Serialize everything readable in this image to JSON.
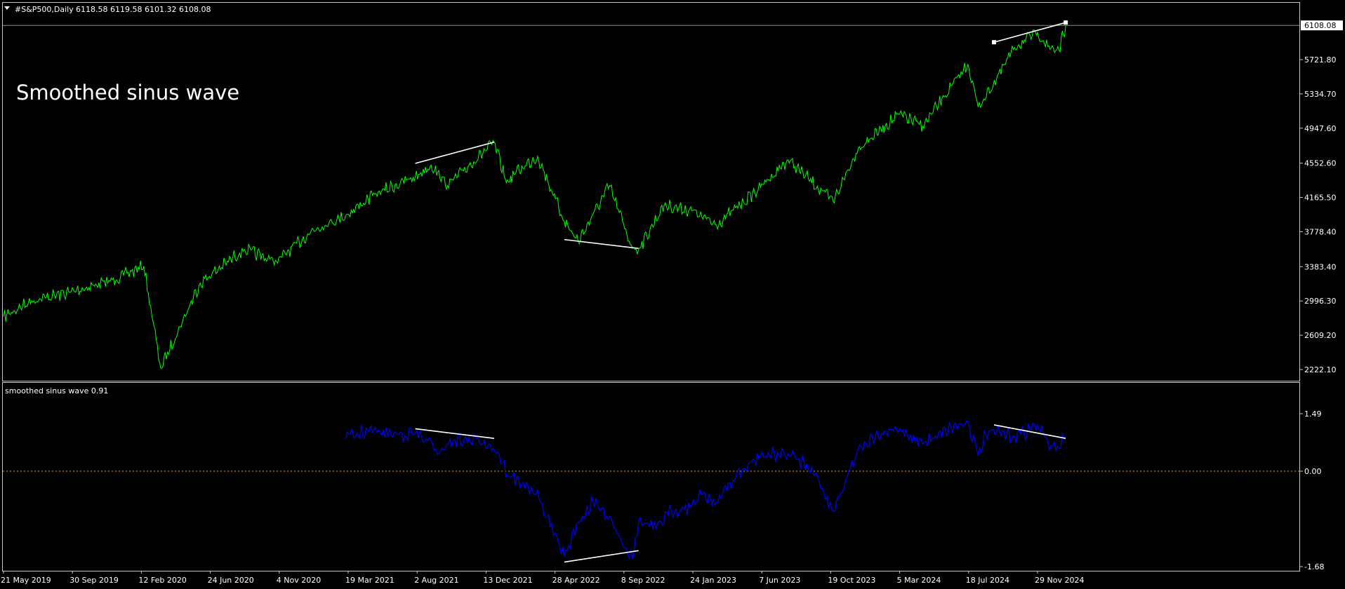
{
  "colors": {
    "background": "#000000",
    "frame": "#c8c8c8",
    "text": "#ffffff",
    "price_line": "#00ff00",
    "indicator_line": "#0000ff",
    "zero_line": "#daa520",
    "trendline": "#ffffff",
    "current_price_marker": "#ffffff"
  },
  "header": {
    "symbol_menu_icon": "triangle-down-icon",
    "symbol": "#S&P500,Daily",
    "ohlc": "6118.58 6119.58 6101.32 6108.08"
  },
  "main_panel": {
    "annotation": "Smoothed sinus wave",
    "y_ticks": [
      "5721.80",
      "5334.70",
      "4947.60",
      "4552.60",
      "4165.50",
      "3778.40",
      "3383.40",
      "2996.30",
      "2609.20",
      "2222.10"
    ],
    "current_price": "6108.08"
  },
  "sub_panel": {
    "label": "smoothed sinus wave 0.91",
    "y_ticks": [
      "1.49",
      "0.00",
      "-1.68"
    ]
  },
  "x_ticks": [
    "21 May 2019",
    "30 Sep 2019",
    "12 Feb 2020",
    "24 Jun 2020",
    "4 Nov 2020",
    "19 Mar 2021",
    "2 Aug 2021",
    "13 Dec 2021",
    "28 Apr 2022",
    "8 Sep 2022",
    "24 Jan 2023",
    "7 Jun 2023",
    "19 Oct 2023",
    "5 Mar 2024",
    "18 Jul 2024",
    "29 Nov 2024"
  ],
  "chart_data": [
    {
      "type": "line",
      "series": [
        {
          "values_note": "",
          "x": [
            "2019-05-21",
            "2019-07-15",
            "2019-09-30",
            "2019-12-15",
            "2020-02-19",
            "2020-03-23",
            "2020-06-08",
            "2020-09-02",
            "2020-11-04",
            "2021-01-15",
            "2021-03-19",
            "2021-05-15",
            "2021-08-02",
            "2021-09-02",
            "2021-10-04",
            "2022-01-03",
            "2022-01-27",
            "2022-02-15",
            "2022-03-29",
            "2022-05-20",
            "2022-06-16",
            "2022-08-16",
            "2022-09-30",
            "2022-10-12",
            "2022-12-01",
            "2023-01-24",
            "2023-03-13",
            "2023-06-07",
            "2023-07-31",
            "2023-10-27",
            "2023-12-15",
            "2024-03-05",
            "2024-04-19",
            "2024-07-16",
            "2024-08-05",
            "2024-09-10",
            "2024-10-15",
            "2024-11-29",
            "2024-12-19",
            "2025-01-10",
            "2025-01-23"
          ],
          "y": [
            2820,
            3000,
            3100,
            3220,
            3390,
            2237,
            3200,
            3580,
            3440,
            3800,
            3960,
            4200,
            4400,
            4530,
            4300,
            4790,
            4330,
            4450,
            4630,
            3900,
            3667,
            4300,
            3590,
            3577,
            4080,
            4015,
            3855,
            4280,
            4590,
            4120,
            4720,
            5110,
            4967,
            5670,
            5186,
            5500,
            5860,
            6030,
            5870,
            5827,
            6108
          ]
        }
      ],
      "y_axis_ticks": [
        5721.8,
        5334.7,
        4947.6,
        4552.6,
        4165.5,
        3778.4,
        3383.4,
        2996.3,
        2609.2,
        2222.1
      ],
      "x_tick_labels": [
        "21 May 2019",
        "30 Sep 2019",
        "12 Feb 2020",
        "24 Jun 2020",
        "4 Nov 2020",
        "19 Mar 2021",
        "2 Aug 2021",
        "13 Dec 2021",
        "28 Apr 2022",
        "8 Sep 2022",
        "24 Jan 2023",
        "7 Jun 2023",
        "19 Oct 2023",
        "5 Mar 2024",
        "18 Jul 2024",
        "29 Nov 2024"
      ],
      "annotations": [
        {
          "text": "Smoothed sinus wave"
        },
        {
          "kind": "trendline",
          "x": [
            "2021-08-02",
            "2022-01-03"
          ],
          "y": [
            4550,
            4790
          ]
        },
        {
          "kind": "trendline",
          "x": [
            "2022-05-20",
            "2022-10-12"
          ],
          "y": [
            3690,
            3590
          ]
        },
        {
          "kind": "trendline",
          "x": [
            "2024-09-05",
            "2025-01-23"
          ],
          "y": [
            5918,
            6140
          ]
        }
      ],
      "grid": false,
      "legend": "none"
    },
    {
      "type": "line",
      "series": [
        {
          "x": [
            "2021-03-19",
            "2021-05-01",
            "2021-07-01",
            "2021-08-02",
            "2021-09-20",
            "2021-10-15",
            "2021-12-15",
            "2022-01-10",
            "2022-02-01",
            "2022-03-01",
            "2022-04-01",
            "2022-05-20",
            "2022-06-16",
            "2022-07-15",
            "2022-08-16",
            "2022-09-30",
            "2022-10-12",
            "2022-11-15",
            "2022-12-15",
            "2023-01-24",
            "2023-02-15",
            "2023-03-13",
            "2023-04-20",
            "2023-06-07",
            "2023-07-31",
            "2023-09-15",
            "2023-10-27",
            "2023-12-15",
            "2024-02-01",
            "2024-03-05",
            "2024-04-19",
            "2024-05-20",
            "2024-07-16",
            "2024-08-05",
            "2024-08-20",
            "2024-09-10",
            "2024-10-15",
            "2024-11-29",
            "2024-12-19",
            "2025-01-10",
            "2025-01-23"
          ],
          "y": [
            0.85,
            1.05,
            0.95,
            1.0,
            0.5,
            0.8,
            0.8,
            0.5,
            -0.1,
            -0.2,
            -0.5,
            -1.5,
            -0.9,
            -0.55,
            -0.8,
            -1.55,
            -0.9,
            -1.0,
            -0.7,
            -0.6,
            -0.4,
            -0.55,
            -0.1,
            0.4,
            0.45,
            0.1,
            -0.7,
            0.6,
            0.95,
            1.1,
            0.7,
            1.0,
            1.3,
            0.4,
            0.95,
            1.0,
            0.9,
            1.2,
            0.75,
            0.6,
            0.91
          ]
        }
      ],
      "y_axis_ticks": [
        1.49,
        0.0,
        -1.68
      ],
      "reference_line": 0.0,
      "annotations": [
        {
          "kind": "trendline",
          "x": [
            "2021-08-02",
            "2022-01-03"
          ],
          "y": [
            1.1,
            0.85
          ]
        },
        {
          "kind": "trendline",
          "x": [
            "2022-05-20",
            "2022-10-12"
          ],
          "y": [
            -1.6,
            -1.4
          ]
        },
        {
          "kind": "trendline",
          "x": [
            "2024-09-05",
            "2025-01-23"
          ],
          "y": [
            1.2,
            0.85
          ]
        }
      ],
      "grid": false,
      "legend": "none"
    }
  ]
}
